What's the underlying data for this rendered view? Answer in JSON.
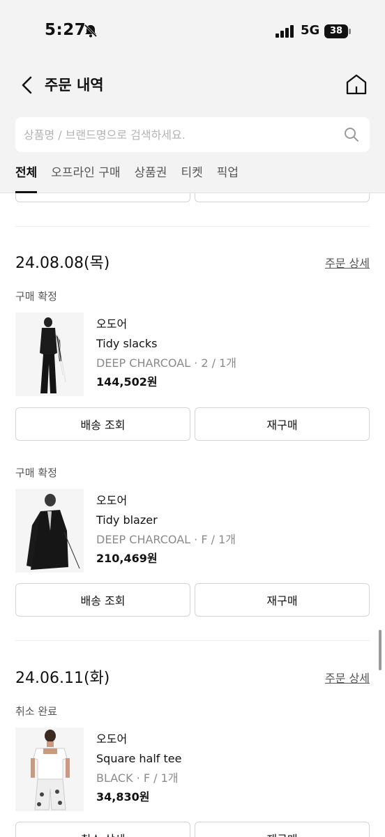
{
  "status_bar": {
    "time": "5:27",
    "network": "5G",
    "battery": "38"
  },
  "nav": {
    "title": "주문 내역"
  },
  "search": {
    "placeholder": "상품명 / 브랜드명으로 검색하세요."
  },
  "tabs": [
    {
      "label": "전체",
      "active": true
    },
    {
      "label": "오프라인 구매",
      "active": false
    },
    {
      "label": "상품권",
      "active": false
    },
    {
      "label": "티켓",
      "active": false
    },
    {
      "label": "픽업",
      "active": false
    }
  ],
  "orders": [
    {
      "date": "24.08.08(목)",
      "detail_label": "주문 상세",
      "items": [
        {
          "status": "구매 확정",
          "brand": "오도어",
          "name": "Tidy slacks",
          "option": "DEEP CHARCOAL · 2 / 1개",
          "price": "144,502원",
          "buttons": [
            "배송 조회",
            "재구매"
          ]
        },
        {
          "status": "구매 확정",
          "brand": "오도어",
          "name": "Tidy blazer",
          "option": "DEEP CHARCOAL · F / 1개",
          "price": "210,469원",
          "buttons": [
            "배송 조회",
            "재구매"
          ]
        }
      ]
    },
    {
      "date": "24.06.11(화)",
      "detail_label": "주문 상세",
      "items": [
        {
          "status": "취소 완료",
          "brand": "오도어",
          "name": "Square half tee",
          "option": "BLACK · F / 1개",
          "price": "34,830원",
          "buttons": [
            "취소 상세",
            "재구매"
          ]
        }
      ]
    }
  ],
  "colors": {
    "header_bg": "#f3f3f3",
    "text_primary": "#111111",
    "text_secondary": "#555555",
    "text_muted": "#8a8a8a",
    "border": "#d4d4d4"
  }
}
